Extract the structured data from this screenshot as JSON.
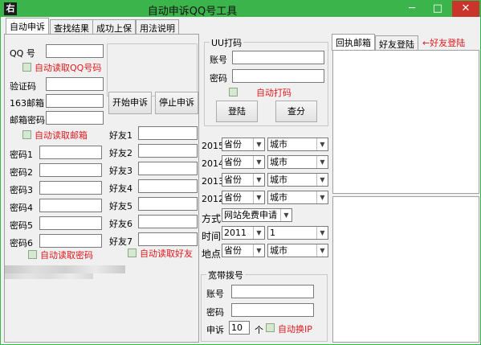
{
  "window": {
    "title": "自动申诉QQ号工具",
    "icon_char": "右",
    "min_glyph": "─",
    "max_glyph": "□",
    "close_glyph": "✕"
  },
  "tabs": [
    "自动申诉",
    "查找结果",
    "成功上保",
    "用法说明"
  ],
  "left": {
    "qq_label": "QQ  号",
    "auto_read_qq": "自动读取QQ号码",
    "captcha_label": "验证码",
    "mail163_label": "163邮箱",
    "mail_pwd_label": "邮箱密码",
    "auto_read_mail": "自动读取邮箱",
    "start_button": "开始申诉",
    "stop_button": "停止申诉",
    "pwd_labels": [
      "密码1",
      "密码2",
      "密码3",
      "密码4",
      "密码5",
      "密码6"
    ],
    "friend_labels": [
      "好友1",
      "好友2",
      "好友3",
      "好友4",
      "好友5",
      "好友6",
      "好友7"
    ],
    "auto_read_pwd": "自动读取密码",
    "auto_read_friend": "自动读取好友"
  },
  "uu": {
    "group_title": "UU打码",
    "account_label": "账号",
    "password_label": "密码",
    "auto_code": "自动打码",
    "login_button": "登陆",
    "query_button": "查分"
  },
  "years": [
    {
      "year": "2015",
      "province": "省份",
      "city": "城市"
    },
    {
      "year": "2014",
      "province": "省份",
      "city": "城市"
    },
    {
      "year": "2013",
      "province": "省份",
      "city": "城市"
    },
    {
      "year": "2012",
      "province": "省份",
      "city": "城市"
    }
  ],
  "method": {
    "label": "方式",
    "value": "网站免费申请"
  },
  "time": {
    "label": "时间",
    "year": "2011",
    "month": "1"
  },
  "location": {
    "label": "地点",
    "province": "省份",
    "city": "城市"
  },
  "broadband": {
    "group_title": "宽带拨号",
    "account_label": "账号",
    "password_label": "密码",
    "appeal_label": "申诉",
    "appeal_value": "10",
    "unit": "个",
    "auto_ip": "自动换IP"
  },
  "right_tabs": {
    "tab1": "回执邮箱",
    "tab2": "好友登陆",
    "note": "←好友登陆"
  }
}
